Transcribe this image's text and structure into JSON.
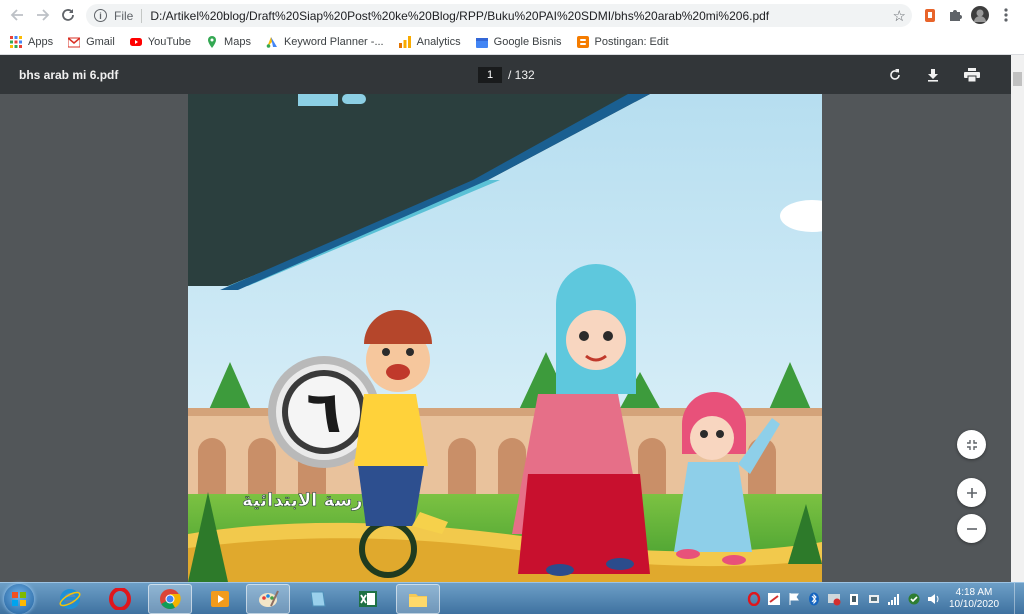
{
  "browser": {
    "scheme_label": "File",
    "url": "D:/Artikel%20blog/Draft%20Siap%20Post%20ke%20Blog/RPP/Buku%20PAI%20SDMI/bhs%20arab%20mi%206.pdf"
  },
  "bookmarks": [
    {
      "label": "Apps",
      "icon": "apps-grid-icon",
      "color": "#4285f4"
    },
    {
      "label": "Gmail",
      "icon": "gmail-icon",
      "color": "#d93025"
    },
    {
      "label": "YouTube",
      "icon": "youtube-icon",
      "color": "#ff0000"
    },
    {
      "label": "Maps",
      "icon": "maps-icon",
      "color": "#34a853"
    },
    {
      "label": "Keyword Planner -...",
      "icon": "keyword-planner-icon",
      "color": "#4285f4"
    },
    {
      "label": "Analytics",
      "icon": "analytics-icon",
      "color": "#f9ab00"
    },
    {
      "label": "Google Bisnis",
      "icon": "google-bisnis-icon",
      "color": "#4285f4"
    },
    {
      "label": "Postingan: Edit",
      "icon": "blogger-icon",
      "color": "#f57c00"
    }
  ],
  "pdf": {
    "title": "bhs arab mi 6.pdf",
    "current_page": "1",
    "total_pages": "/ 132"
  },
  "book": {
    "grade_numeral": "٦",
    "school_text": "المدرسة الابتدائية"
  },
  "clock": {
    "time": "4:18 AM",
    "date": "10/10/2020"
  },
  "colors": {
    "pdf_toolbar": "#323639",
    "viewer_bg": "#525659"
  }
}
